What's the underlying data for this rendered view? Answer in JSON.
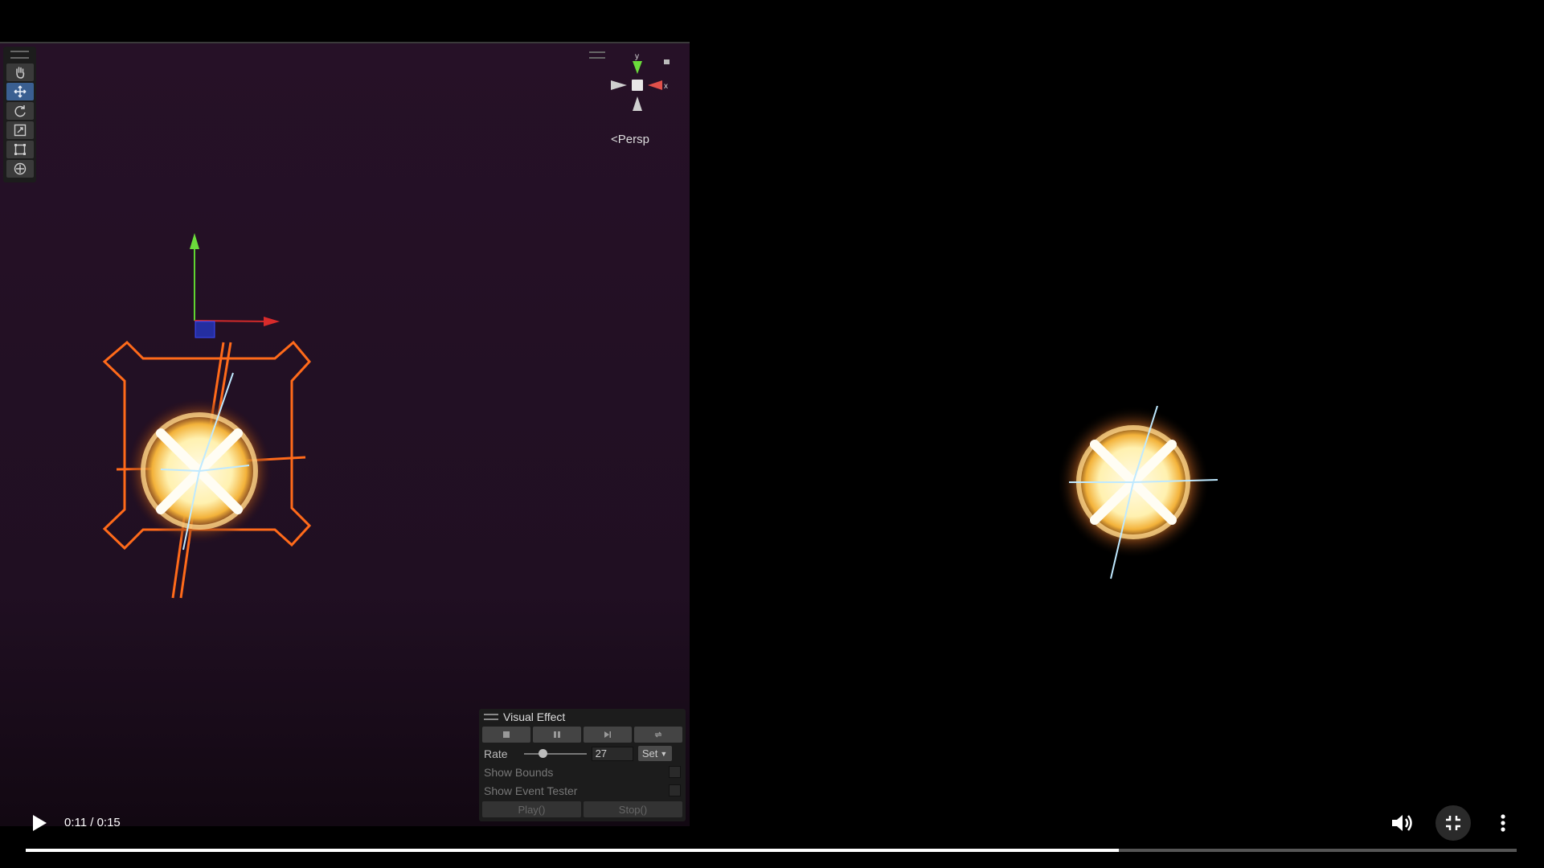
{
  "scene": {
    "view_mode": "Persp",
    "gizmo_axes": {
      "y": "y",
      "x": "x"
    },
    "tools": [
      {
        "name": "hand-tool",
        "icon": "hand-icon",
        "active": false
      },
      {
        "name": "move-tool",
        "icon": "move-icon",
        "active": true
      },
      {
        "name": "rotate-tool",
        "icon": "rotate-icon",
        "active": false
      },
      {
        "name": "scale-tool",
        "icon": "scale-icon",
        "active": false
      },
      {
        "name": "rect-tool",
        "icon": "rect-icon",
        "active": false
      },
      {
        "name": "transform-tool",
        "icon": "transform-icon",
        "active": false
      }
    ]
  },
  "vfx_panel": {
    "title": "Visual Effect",
    "rate_label": "Rate",
    "rate_value": "27",
    "rate_fraction": 0.3,
    "set_label": "Set",
    "show_bounds_label": "Show Bounds",
    "show_event_tester_label": "Show Event Tester",
    "play_label": "Play()",
    "stop_label": "Stop()"
  },
  "player": {
    "time": "0:11 / 0:15",
    "progress_fraction": 0.733,
    "colors": {
      "accent": "#ffffff",
      "track": "#555555"
    }
  }
}
